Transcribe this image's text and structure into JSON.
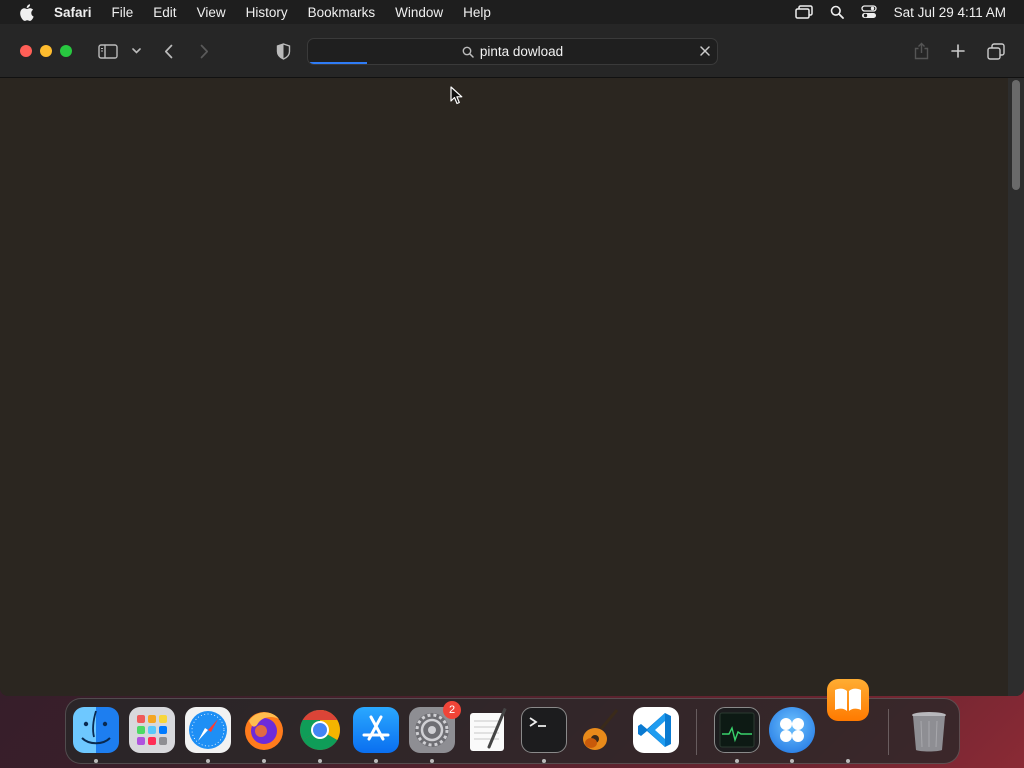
{
  "menubar": {
    "apple_icon": "apple-logo-icon",
    "app_name": "Safari",
    "items": [
      "File",
      "Edit",
      "View",
      "History",
      "Bookmarks",
      "Window",
      "Help"
    ],
    "status_icons": [
      "screen-mirroring-icon",
      "spotlight-search-icon",
      "control-center-icon"
    ],
    "clock": "Sat Jul 29  4:11 AM"
  },
  "toolbar": {
    "traffic_lights": [
      "close",
      "minimize",
      "zoom"
    ],
    "address_bar": {
      "query": "pinta dowload",
      "icon": "search-icon",
      "loading_progress": 0.14
    },
    "buttons": [
      "sidebar-toggle",
      "tab-group-menu",
      "back",
      "forward",
      "privacy-shield",
      "share",
      "new-tab",
      "tab-overview"
    ]
  },
  "page": {
    "background": "#2b2620",
    "scrollbar_position": 0.0
  },
  "dock": {
    "apps": [
      {
        "name": "Finder",
        "running": true
      },
      {
        "name": "Launchpad",
        "running": false
      },
      {
        "name": "Safari",
        "running": true
      },
      {
        "name": "Firefox",
        "running": true
      },
      {
        "name": "Chrome",
        "running": true
      },
      {
        "name": "App Store",
        "running": true
      },
      {
        "name": "System Settings",
        "running": true,
        "badge": "2"
      },
      {
        "name": "TextEdit",
        "running": false
      },
      {
        "name": "Terminal",
        "running": true
      },
      {
        "name": "GarageBand",
        "running": false
      },
      {
        "name": "Visual Studio Code",
        "running": false
      },
      {
        "name": "Activity Monitor",
        "running": true
      },
      {
        "name": "App Launcher",
        "running": true
      },
      {
        "name": "Books",
        "running": true
      },
      {
        "name": "Trash",
        "running": false
      }
    ]
  },
  "colors": {
    "accent": "#2f7cf6",
    "traffic_close": "#ff5f57",
    "traffic_minimize": "#febc2e",
    "traffic_zoom": "#28c840",
    "badge": "#f04438"
  }
}
